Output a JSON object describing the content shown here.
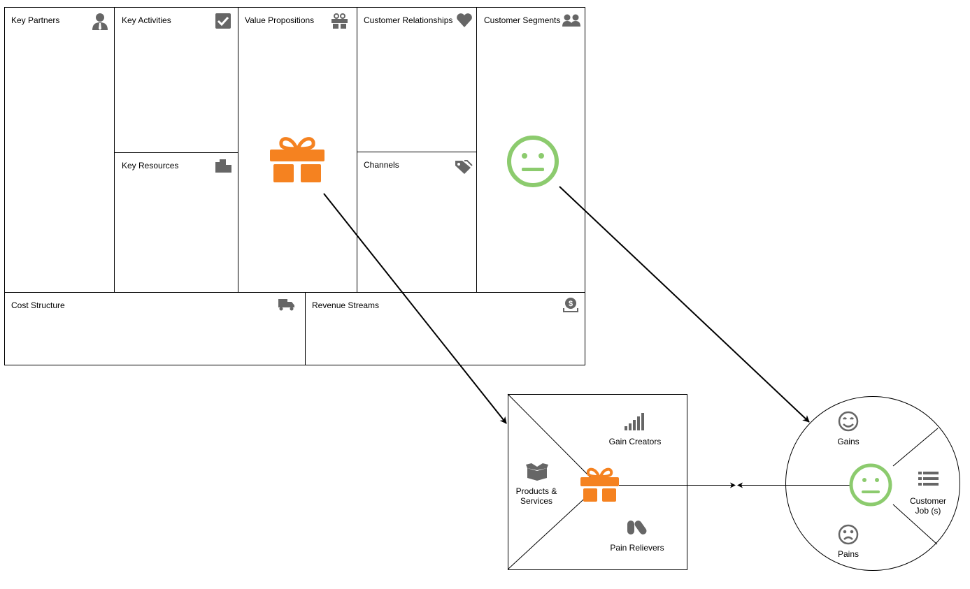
{
  "canvas": {
    "cells": {
      "key_partners": "Key Partners",
      "key_activities": "Key Activities",
      "key_resources": "Key Resources",
      "value_propositions": "Value Propositions",
      "customer_relationships": "Customer Relationships",
      "channels": "Channels",
      "customer_segments": "Customer Segments",
      "cost_structure": "Cost Structure",
      "revenue_streams": "Revenue Streams"
    }
  },
  "value_map": {
    "gain_creators": "Gain Creators",
    "products_line1": "Products &",
    "products_line2": "Services",
    "pain_relievers": "Pain Relievers"
  },
  "customer_profile": {
    "gains": "Gains",
    "pains": "Pains",
    "jobs_line1": "Customer",
    "jobs_line2": "Job (s)"
  },
  "colors": {
    "accent_orange": "#f58220",
    "accent_green": "#8ccb6e",
    "icon_gray": "#666666"
  },
  "icons": [
    "person-tie-icon",
    "checkbox-icon",
    "gift-icon",
    "heart-icon",
    "users-icon",
    "buildings-icon",
    "tags-icon",
    "truck-icon",
    "money-bag-icon",
    "signal-bars-icon",
    "box-icon",
    "pills-icon",
    "smile-icon",
    "sad-icon",
    "list-icon",
    "neutral-face-icon"
  ]
}
